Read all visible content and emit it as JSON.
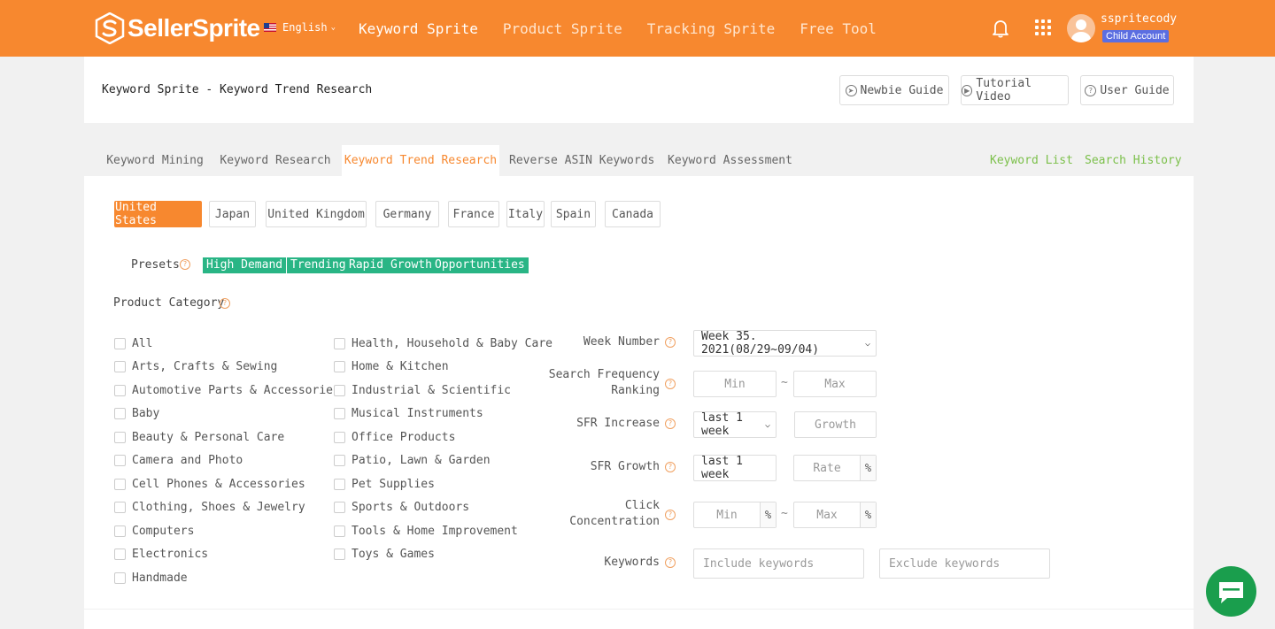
{
  "brand": {
    "name": "SellerSprite",
    "accent": "#f7882f",
    "green": "#29b585",
    "link_green": "#7cc04b"
  },
  "topbar": {
    "language": "English",
    "nav": [
      "Keyword Sprite",
      "Product Sprite",
      "Tracking Sprite",
      "Free Tool"
    ],
    "active_nav": "Keyword Sprite",
    "icons": [
      "bell-icon",
      "apps-grid-icon"
    ],
    "user": {
      "name": "sspritecody",
      "badge": "Child Account"
    }
  },
  "header": {
    "breadcrumb": "Keyword Sprite - Keyword Trend Research",
    "buttons": [
      "Newbie Guide",
      "Tutorial Video",
      "User Guide"
    ]
  },
  "tabs": {
    "items": [
      "Keyword Mining",
      "Keyword Research",
      "Keyword Trend Research",
      "Reverse ASIN Keywords",
      "Keyword Assessment"
    ],
    "active": "Keyword Trend Research",
    "links": [
      "Keyword List",
      "Search History"
    ]
  },
  "countries": {
    "items": [
      "United States",
      "Japan",
      "United Kingdom",
      "Germany",
      "France",
      "Italy",
      "Spain",
      "Canada"
    ],
    "active": "United States"
  },
  "presets": {
    "label": "Presets",
    "items": [
      "High Demand",
      "Trending",
      "Rapid Growth",
      "Opportunities"
    ]
  },
  "category": {
    "label": "Product Category",
    "left": [
      "All",
      "Arts, Crafts & Sewing",
      "Automotive Parts & Accessories",
      "Baby",
      "Beauty & Personal Care",
      "Camera and Photo",
      "Cell Phones & Accessories",
      "Clothing, Shoes & Jewelry",
      "Computers",
      "Electronics",
      "Handmade"
    ],
    "right": [
      "Health, Household & Baby Care",
      "Home & Kitchen",
      "Industrial & Scientific",
      "Musical Instruments",
      "Office Products",
      "Patio, Lawn & Garden",
      "Pet Supplies",
      "Sports & Outdoors",
      "Tools & Home Improvement",
      "Toys & Games"
    ]
  },
  "filters": {
    "week_number": {
      "label": "Week Number",
      "value": "Week 35. 2021(08/29~09/04)"
    },
    "sfr": {
      "label_line1": "Search Frequency",
      "label_line2": "Ranking",
      "min_placeholder": "Min",
      "max_placeholder": "Max",
      "sep": "~"
    },
    "sfr_increase": {
      "label": "SFR Increase",
      "period": "last 1 week",
      "placeholder": "Growth"
    },
    "sfr_growth": {
      "label": "SFR Growth",
      "period": "last 1 week",
      "placeholder": "Rate",
      "unit": "%"
    },
    "click": {
      "label_line1": "Click",
      "label_line2": "Concentration",
      "min_placeholder": "Min",
      "max_placeholder": "Max",
      "unit": "%",
      "sep": "~"
    },
    "keywords": {
      "label": "Keywords",
      "include_placeholder": "Include keywords",
      "exclude_placeholder": "Exclude keywords"
    }
  },
  "help_glyph": "?"
}
